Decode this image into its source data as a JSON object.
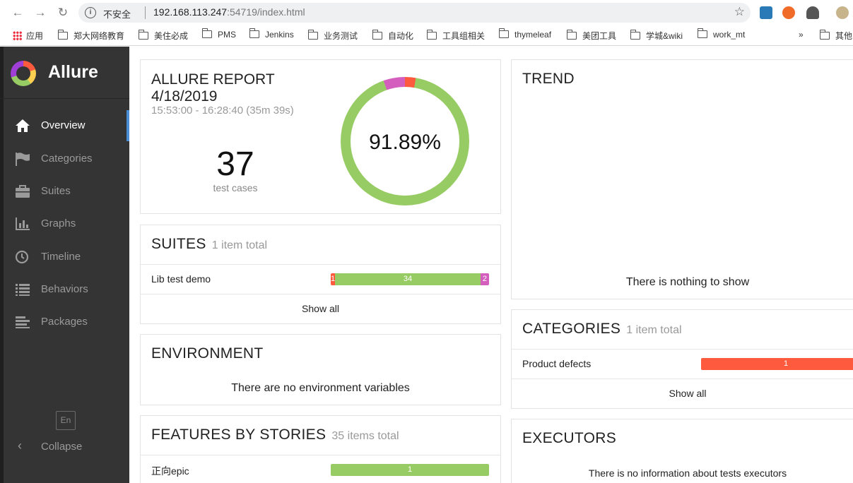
{
  "browser": {
    "insecure_label": "不安全",
    "url_host": "192.168.113.247",
    "url_rest": ":54719/index.html",
    "bookmarks": [
      {
        "label": "应用"
      },
      {
        "label": "郑大网络教育"
      },
      {
        "label": "美住必成"
      },
      {
        "label": "PMS"
      },
      {
        "label": "Jenkins"
      },
      {
        "label": "业务测试"
      },
      {
        "label": "自动化"
      },
      {
        "label": "工具组相关"
      },
      {
        "label": "thymeleaf"
      },
      {
        "label": "美团工具"
      },
      {
        "label": "学城&wiki"
      },
      {
        "label": "work_mt"
      },
      {
        "label": "»"
      },
      {
        "label": "其他"
      }
    ]
  },
  "sidebar": {
    "brand": "Allure",
    "items": [
      {
        "label": "Overview",
        "icon": "home-icon"
      },
      {
        "label": "Categories",
        "icon": "flag-icon"
      },
      {
        "label": "Suites",
        "icon": "briefcase-icon"
      },
      {
        "label": "Graphs",
        "icon": "bar-chart-icon"
      },
      {
        "label": "Timeline",
        "icon": "clock-icon"
      },
      {
        "label": "Behaviors",
        "icon": "list-icon"
      },
      {
        "label": "Packages",
        "icon": "align-left-icon"
      }
    ],
    "language": "En",
    "collapse_label": "Collapse"
  },
  "summary": {
    "title_line1": "ALLURE REPORT",
    "title_line2": "4/18/2019",
    "time_range": "15:53:00 - 16:28:40 (35m 39s)",
    "test_count": "37",
    "test_count_label": "test cases",
    "success_rate": "91.89%",
    "donut": {
      "passed": 34,
      "broken": 2,
      "failed": 1
    }
  },
  "suites": {
    "title": "SUITES",
    "count": "1 item total",
    "rows": [
      {
        "name": "Lib test demo",
        "failed": 1,
        "passed": 34,
        "broken": 2
      }
    ],
    "show_all": "Show all"
  },
  "environment": {
    "title": "ENVIRONMENT",
    "message": "There are no environment variables"
  },
  "features": {
    "title": "FEATURES BY STORIES",
    "count": "35 items total",
    "rows": [
      {
        "name": "正向epic",
        "passed": 1
      }
    ]
  },
  "trend": {
    "title": "TREND",
    "message": "There is nothing to show"
  },
  "categories": {
    "title": "CATEGORIES",
    "count": "1 item total",
    "rows": [
      {
        "name": "Product defects",
        "failed": 1
      }
    ],
    "show_all": "Show all"
  },
  "executors": {
    "title": "EXECUTORS",
    "message": "There is no information about tests executors"
  },
  "colors": {
    "failed": "#fd5a3e",
    "passed": "#97cc64",
    "broken": "#d35ebe",
    "sidebar_bg": "#343434",
    "active_marker": "#4a8fd6"
  }
}
